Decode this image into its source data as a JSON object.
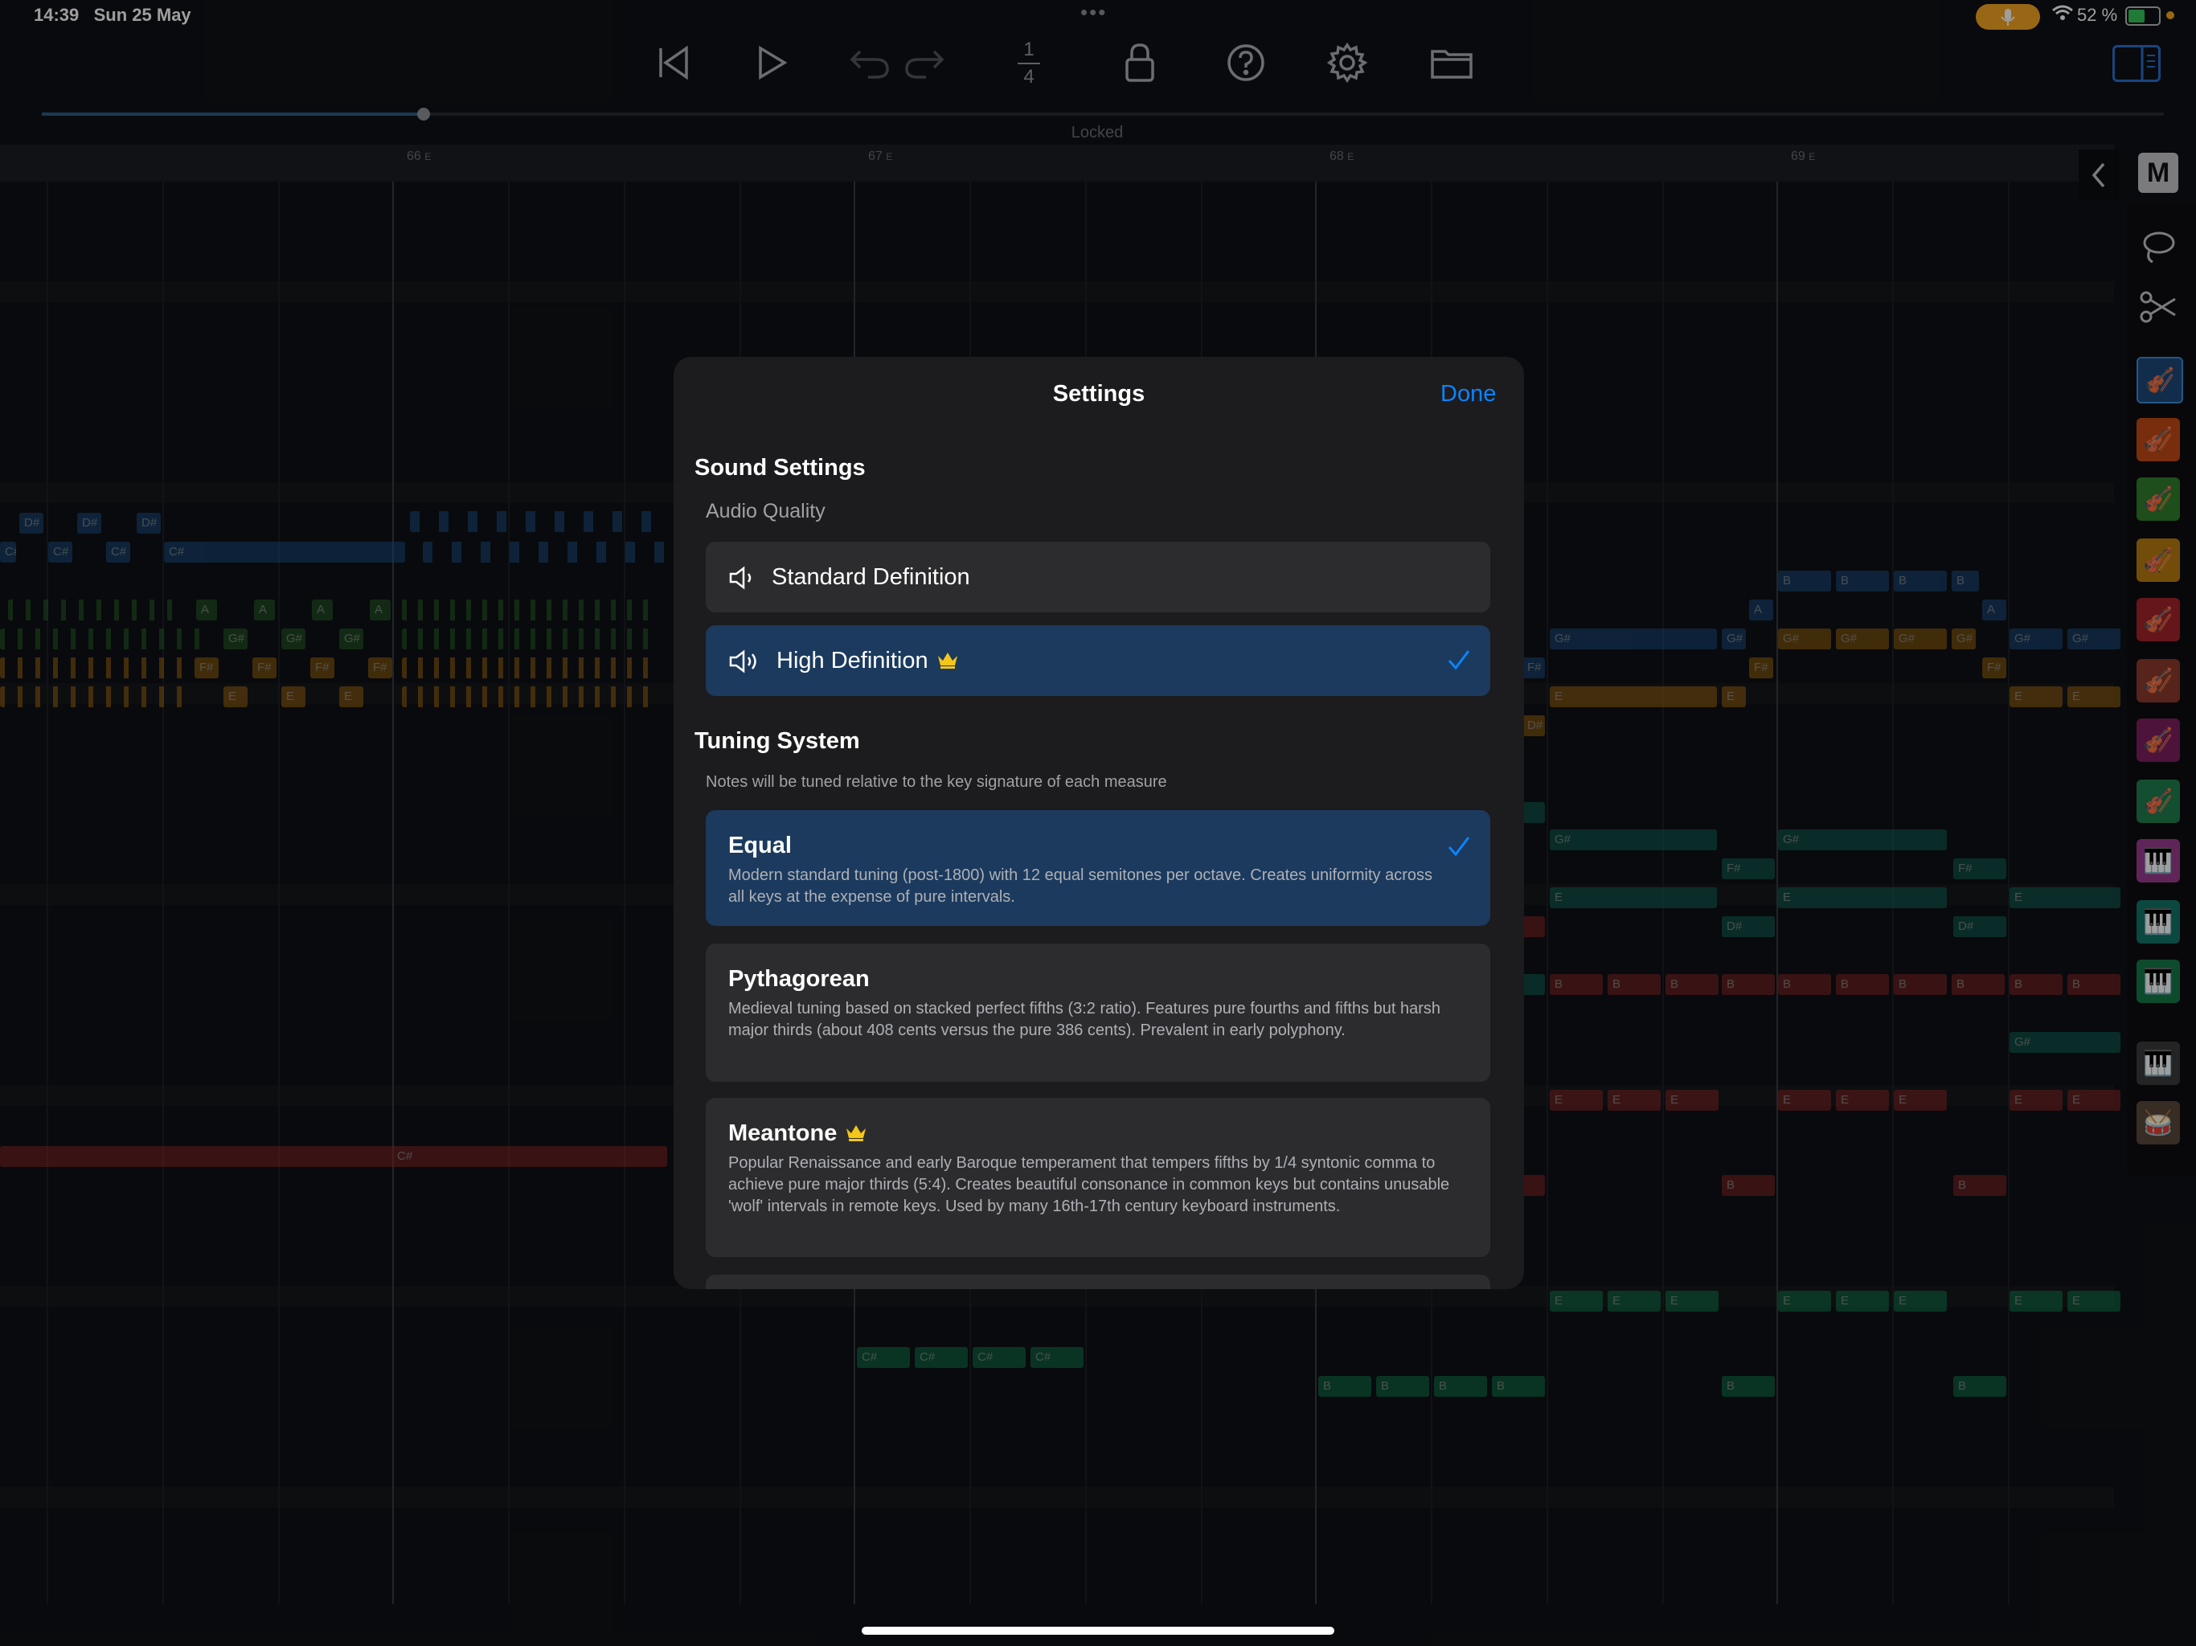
{
  "status_bar": {
    "time": "14:39",
    "date": "Sun 25 May",
    "battery": "52 %",
    "dots": "•••"
  },
  "toolbar": {
    "time_signature_top": "1",
    "time_signature_bottom": "4",
    "locked_label": "Locked",
    "progress": 0.18
  },
  "ruler": {
    "measures": [
      "66",
      "67",
      "68",
      "69"
    ],
    "key": "E"
  },
  "side": {
    "mode_badge": "M"
  },
  "notes": {
    "dsharp": "D#",
    "csharp": "C#",
    "a": "A",
    "gsharp": "G#",
    "fsharp": "F#",
    "e": "E",
    "b": "B"
  },
  "settings": {
    "title": "Settings",
    "done_label": "Done",
    "sound_section_title": "Sound Settings",
    "audio_quality_label": "Audio Quality",
    "audio_options": [
      {
        "label": "Standard Definition",
        "selected": false,
        "premium": false
      },
      {
        "label": "High Definition",
        "selected": true,
        "premium": true
      }
    ],
    "tuning_section_title": "Tuning System",
    "tuning_note": "Notes will be tuned relative to the key signature of each measure",
    "tuning_options": [
      {
        "name": "Equal",
        "selected": true,
        "premium": false,
        "description": "Modern standard tuning (post-1800) with 12 equal semitones per octave. Creates uniformity across all keys at the expense of pure intervals."
      },
      {
        "name": "Pythagorean",
        "selected": false,
        "premium": false,
        "description": "Medieval tuning based on stacked perfect fifths (3:2 ratio). Features pure fourths and fifths but harsh major thirds (about 408 cents versus the pure 386 cents). Prevalent in early polyphony."
      },
      {
        "name": "Meantone",
        "selected": false,
        "premium": true,
        "description": "Popular Renaissance and early Baroque temperament that tempers fifths by 1/4 syntonic comma to achieve pure major thirds (5:4). Creates beautiful consonance in common keys but contains unusable 'wolf' intervals in remote keys. Used by many 16th-17th century keyboard instruments."
      }
    ]
  },
  "colors": {
    "accent": "#0a84ff",
    "selected_bg": "#1b3a5e",
    "crown": "#f5c518"
  }
}
